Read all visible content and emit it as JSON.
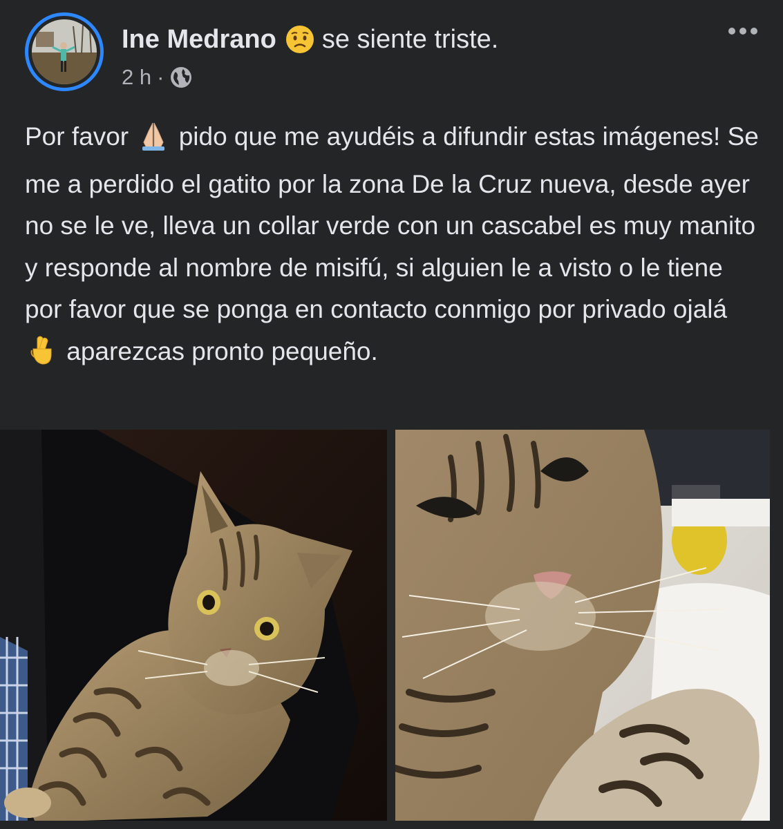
{
  "post": {
    "author": "Ine Medrano",
    "feeling": "se siente triste.",
    "feeling_icon": "sad-face-icon",
    "timestamp": "2 h",
    "separator": "·",
    "audience_icon": "globe-icon",
    "more_icon": "more-options-icon",
    "text": {
      "part1": "Por favor",
      "part2": "pido que me ayudéis a difundir estas imágenes! Se me a perdido el gatito por la zona De la Cruz nueva, desde ayer no se le ve, lleva un collar verde con un cascabel es muy manito y responde al nombre de misifú, si alguien le a visto o le tiene por favor que se ponga en contacto conmigo por privado ojalá",
      "part3": "aparezcas pronto pequeño.",
      "emoji1": "folded-hands-icon",
      "emoji2": "crossed-fingers-icon"
    },
    "photos": [
      "tabby-cat-held-photo",
      "tabby-cat-closeup-photo"
    ]
  },
  "colors": {
    "background": "#242526",
    "text_primary": "#e4e6eb",
    "text_secondary": "#b0b3b8",
    "story_ring": "#2d88ff"
  }
}
